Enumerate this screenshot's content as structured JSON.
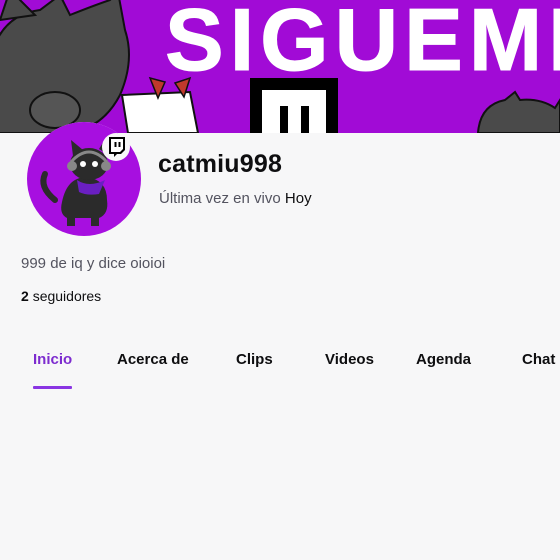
{
  "banner": {
    "text": "SIGUEME",
    "background_color": "#a10bd6"
  },
  "channel": {
    "name": "catmiu998",
    "last_live_label": "Última vez en vivo",
    "last_live_value": "Hoy",
    "bio": "999 de iq y dice oioioi",
    "followers_count": "2",
    "followers_label": "seguidores"
  },
  "tabs": [
    {
      "label": "Inicio",
      "active": true
    },
    {
      "label": "Acerca de",
      "active": false
    },
    {
      "label": "Clips",
      "active": false
    },
    {
      "label": "Videos",
      "active": false
    },
    {
      "label": "Agenda",
      "active": false
    },
    {
      "label": "Chat",
      "active": false
    }
  ],
  "colors": {
    "accent": "#7d2ccf",
    "avatar_bg": "#a70fe0",
    "page_bg": "#f7f7f8"
  },
  "icons": {
    "badge": "twitch-icon"
  }
}
